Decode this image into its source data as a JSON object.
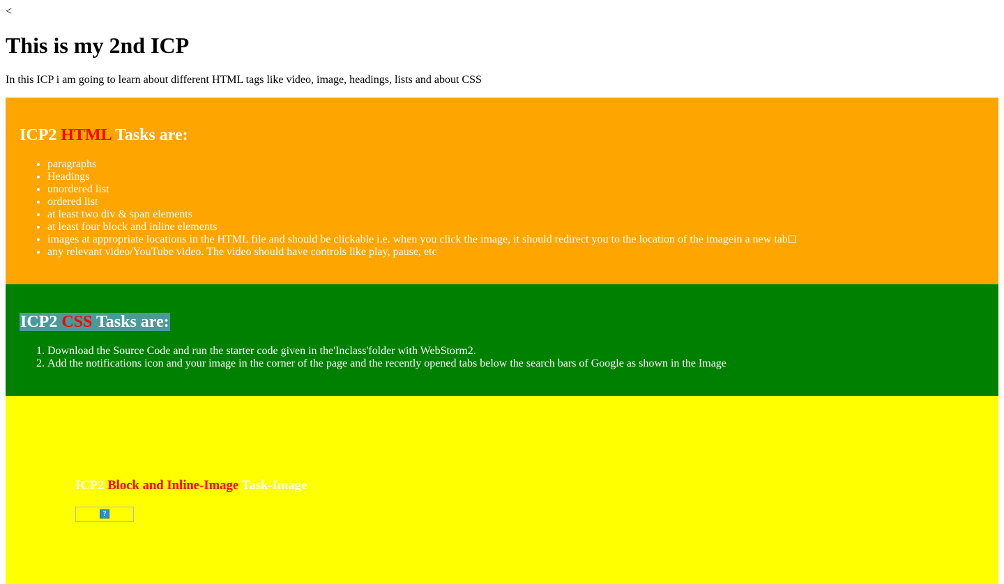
{
  "stray_text": "<",
  "page_title": "This is my 2nd ICP",
  "intro": "In this ICP i am going to learn about different HTML tags like video, image, headings, lists and about CSS",
  "html_section": {
    "heading_prefix": "ICP2",
    "heading_highlight": "HTML",
    "heading_suffix": "Tasks are:",
    "background_color": "#ffa500",
    "items": [
      "paragraphs",
      "Headings",
      "unordered list",
      "ordered list",
      "at least two div & span elements",
      "at least four block and inline elements",
      "images at appropriate locations in the HTML file and should be clickable i.e. when you click the image, it should redirect you to the location of the imagein a new tab",
      "any relevant video/YouTube video. The video should have controls like play, pause, etc"
    ]
  },
  "css_section": {
    "heading_prefix": "ICP2",
    "heading_highlight": "CSS",
    "heading_suffix": "Tasks are:",
    "background_color": "#008000",
    "items": [
      "Download the Source Code and run the starter code given in the'Inclass'folder with WebStorm2.",
      "Add the notifications icon and your image in the corner of the page and the recently opened tabs below the search bars of Google as shown in the Image"
    ]
  },
  "image_section": {
    "heading_prefix": "ICP2",
    "heading_highlight": "Block and Inline-Image",
    "heading_suffix": "Task-Image",
    "background_color": "#ffff00",
    "broken_image_glyph": "?"
  },
  "colors": {
    "highlight_red": "#ff0000",
    "heading_bg_highlight": "#4a9a9a"
  }
}
